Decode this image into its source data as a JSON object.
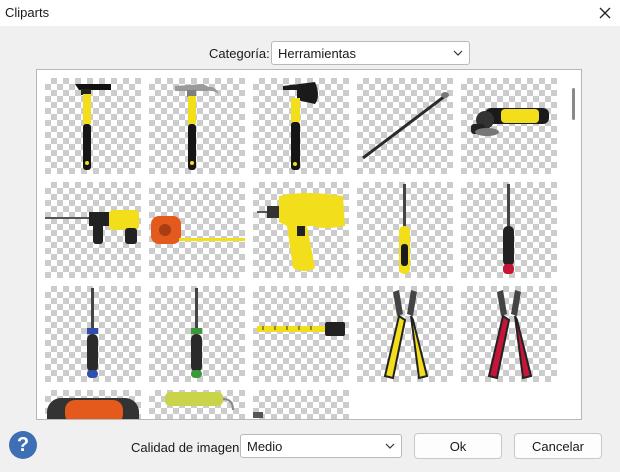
{
  "window": {
    "title": "Cliparts"
  },
  "category": {
    "label": "Categoría:",
    "value": "Herramientas"
  },
  "gallery": {
    "items": [
      {
        "name": "hammer"
      },
      {
        "name": "claw-hammer"
      },
      {
        "name": "axe"
      },
      {
        "name": "nail"
      },
      {
        "name": "angle-grinder"
      },
      {
        "name": "rotary-hammer"
      },
      {
        "name": "tape-measure"
      },
      {
        "name": "power-drill"
      },
      {
        "name": "yellow-screwdriver"
      },
      {
        "name": "red-screwdriver"
      },
      {
        "name": "blue-screwdriver"
      },
      {
        "name": "green-screwdriver"
      },
      {
        "name": "folding-ruler"
      },
      {
        "name": "yellow-pliers"
      },
      {
        "name": "red-pliers"
      },
      {
        "name": "orange-tool"
      },
      {
        "name": "paint-roller"
      },
      {
        "name": "tool-partial"
      }
    ]
  },
  "quality": {
    "label": "Calidad de imagen:",
    "value": "Medio"
  },
  "buttons": {
    "ok": "Ok",
    "cancel": "Cancelar"
  },
  "colors": {
    "help": "#3e6fb5",
    "tool_yellow": "#f2de1a",
    "checker": "#cccccc"
  }
}
